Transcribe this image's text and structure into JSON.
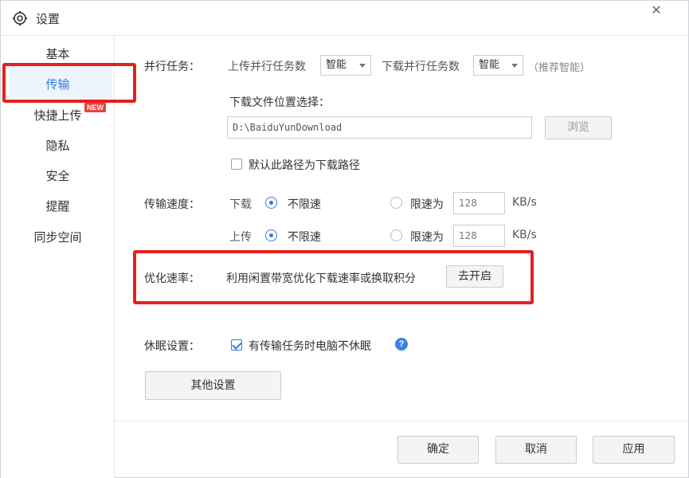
{
  "window": {
    "title": "设置",
    "icons": {
      "settings": "gear-icon",
      "close": "close-icon"
    }
  },
  "sidebar": {
    "items": [
      {
        "label": "基本"
      },
      {
        "label": "传输",
        "active": true
      },
      {
        "label": "快捷上传",
        "badge": "NEW"
      },
      {
        "label": "隐私"
      },
      {
        "label": "安全"
      },
      {
        "label": "提醒"
      },
      {
        "label": "同步空间"
      }
    ]
  },
  "parallel": {
    "label": "并行任务：",
    "upload_label": "上传并行任务数",
    "upload_value": "智能",
    "download_label": "下载并行任务数",
    "download_value": "智能",
    "hint": "（推荐智能）"
  },
  "download_location": {
    "label": "下载文件位置选择：",
    "path": "D:\\BaiduYunDownload",
    "browse_label": "浏览",
    "default_checkbox_label": "默认此路径为下载路径",
    "default_checked": false
  },
  "speed": {
    "label": "传输速度：",
    "download": {
      "label": "下载",
      "unlimited_label": "不限速",
      "limit_label": "限速为",
      "limit_value": "128",
      "unit": "KB/s",
      "selected": "unlimited"
    },
    "upload": {
      "label": "上传",
      "unlimited_label": "不限速",
      "limit_label": "限速为",
      "limit_value": "128",
      "unit": "KB/s",
      "selected": "unlimited"
    }
  },
  "optimize": {
    "label": "优化速率：",
    "description": "利用闲置带宽优化下载速率或换取积分",
    "button_label": "去开启"
  },
  "sleep": {
    "label": "休眠设置：",
    "checkbox_label": "有传输任务时电脑不休眠",
    "checked": true,
    "help_icon": "question-icon"
  },
  "other_settings_label": "其他设置",
  "footer": {
    "ok_label": "确定",
    "cancel_label": "取消",
    "apply_label": "应用"
  },
  "colors": {
    "accent": "#2f7be5",
    "highlight": "#e42121",
    "badge": "#e8413a"
  }
}
